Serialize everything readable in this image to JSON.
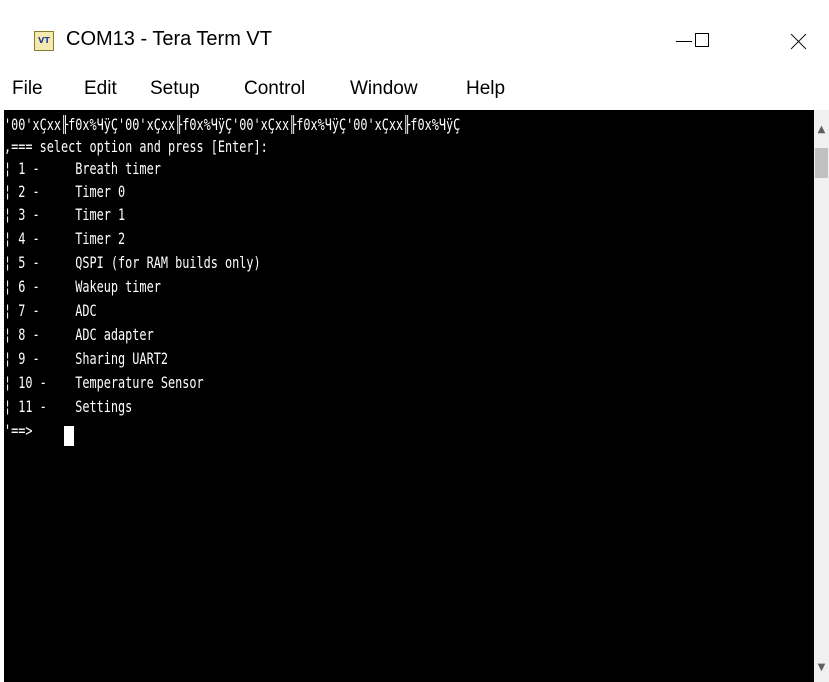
{
  "window": {
    "title": "COM13 - Tera Term VT",
    "icon_label": "VT",
    "icon_name": "tera-term-icon"
  },
  "menu": [
    "File",
    "Edit",
    "Setup",
    "Control",
    "Window",
    "Help"
  ],
  "terminal": {
    "header_noise": "'00'xÇxx╟f0x%ЧÿÇ'00'xÇxx╟f0x%ЧÿÇ'00'xÇxx╟f0x%ЧÿÇ'00'xÇxx╟f0x%ЧÿÇ",
    "prompt_title": ",=== select option and press [Enter]:",
    "options": [
      "¦ 1 -     Breath timer",
      "¦ 2 -     Timer 0",
      "¦ 3 -     Timer 1",
      "¦ 4 -     Timer 2",
      "¦ 5 -     QSPI (for RAM builds only)",
      "¦ 6 -     Wakeup timer",
      "¦ 7 -     ADC",
      "¦ 8 -     ADC adapter",
      "¦ 9 -     Sharing UART2",
      "¦ 10 -    Temperature Sensor",
      "¦ 11 -    Settings"
    ],
    "input_prompt": "'==>"
  },
  "colors": {
    "terminal_bg": "#000000",
    "terminal_fg": "#ffffff",
    "titlebar_bg": "#ffffff"
  }
}
